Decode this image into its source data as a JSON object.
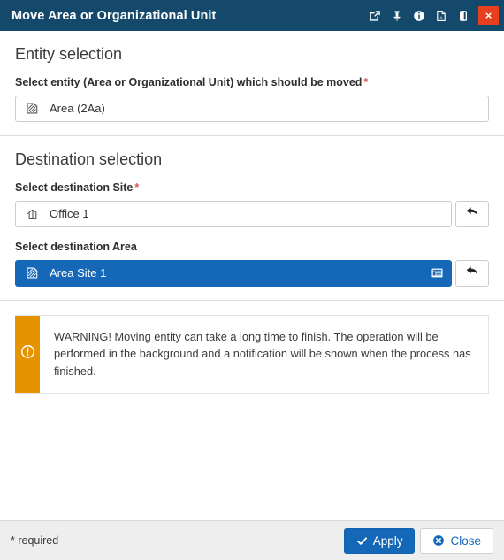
{
  "window": {
    "title": "Move Area or Organizational Unit",
    "title_icons": [
      {
        "name": "open-in-new-window-icon",
        "label": "Open in new window"
      },
      {
        "name": "pin-icon",
        "label": "Pin"
      },
      {
        "name": "info-icon",
        "label": "Info"
      },
      {
        "name": "pdf-icon",
        "label": "Export PDF"
      },
      {
        "name": "expand-icon",
        "label": "Expand"
      }
    ],
    "close_label": "×",
    "accent_titlebar": "#14496b",
    "accent_close": "#e8401f"
  },
  "entity_section": {
    "heading": "Entity selection",
    "field_label": "Select entity (Area or Organizational Unit) which should be moved",
    "required_marker": "*",
    "value": "Area (2Aa)",
    "value_icon": "area-icon"
  },
  "destination_section": {
    "heading": "Destination selection",
    "site": {
      "label": "Select destination Site",
      "required_marker": "*",
      "value": "Office 1",
      "value_icon": "site-icon",
      "back_button": "back-arrow-icon"
    },
    "area": {
      "label": "Select destination Area",
      "required_marker": "",
      "value": "Area Site 1",
      "value_icon": "area-icon",
      "trailing_icon": "list-details-icon",
      "back_button": "back-arrow-icon",
      "selected": true,
      "selected_color": "#1568b8"
    }
  },
  "warning": {
    "icon": "exclamation-circle-icon",
    "bar_color": "#e59400",
    "text": "WARNING! Moving entity can take a long time to finish. The operation will be performed in the background and a notification will be shown when the process has finished."
  },
  "footer": {
    "required_note": "* required",
    "apply_label": "Apply",
    "apply_icon": "check-icon",
    "close_label": "Close",
    "close_icon": "close-circle-icon",
    "primary_color": "#1568b8"
  }
}
